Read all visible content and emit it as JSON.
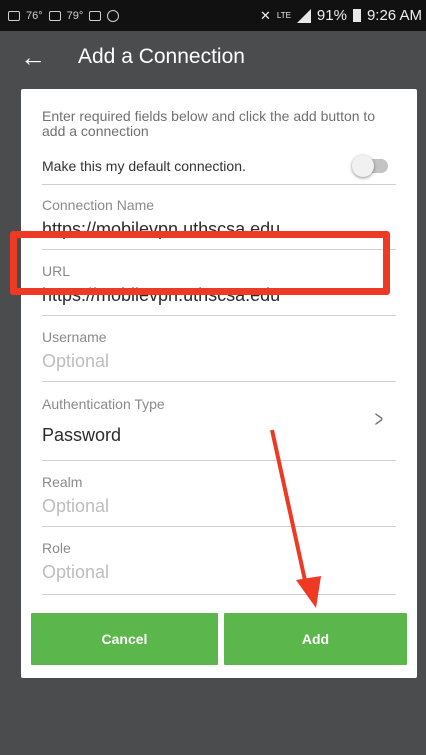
{
  "statusbar": {
    "left_icons": [
      "gallery-icon",
      "temperature-76-icon",
      "mail-icon",
      "temperature-79-icon",
      "voicemail-icon",
      "sync-icon"
    ],
    "temp1": "76°",
    "temp2": "79°",
    "network": "LTE",
    "battery": "91%",
    "time": "9:26 AM"
  },
  "appbar": {
    "title": "Add a Connection",
    "back_icon": "arrow-left-icon"
  },
  "form": {
    "intro": "Enter required fields below and click the add button to add a connection",
    "default_toggle": {
      "label": "Make this my default connection.",
      "on": false
    },
    "connection_name": {
      "label": "Connection Name",
      "value": "https://mobilevpn.uthscsa.edu"
    },
    "url": {
      "label": "URL",
      "value": "https://mobilevpn.uthscsa.edu"
    },
    "username": {
      "label": "Username",
      "placeholder": "Optional"
    },
    "auth_type": {
      "label": "Authentication Type",
      "value": "Password"
    },
    "realm": {
      "label": "Realm",
      "placeholder": "Optional"
    },
    "role": {
      "label": "Role",
      "placeholder": "Optional"
    }
  },
  "buttons": {
    "cancel": "Cancel",
    "add": "Add"
  },
  "colors": {
    "accent": "#5bb64b",
    "highlight": "#ee3a24",
    "appbar": "#4b4c4e"
  }
}
